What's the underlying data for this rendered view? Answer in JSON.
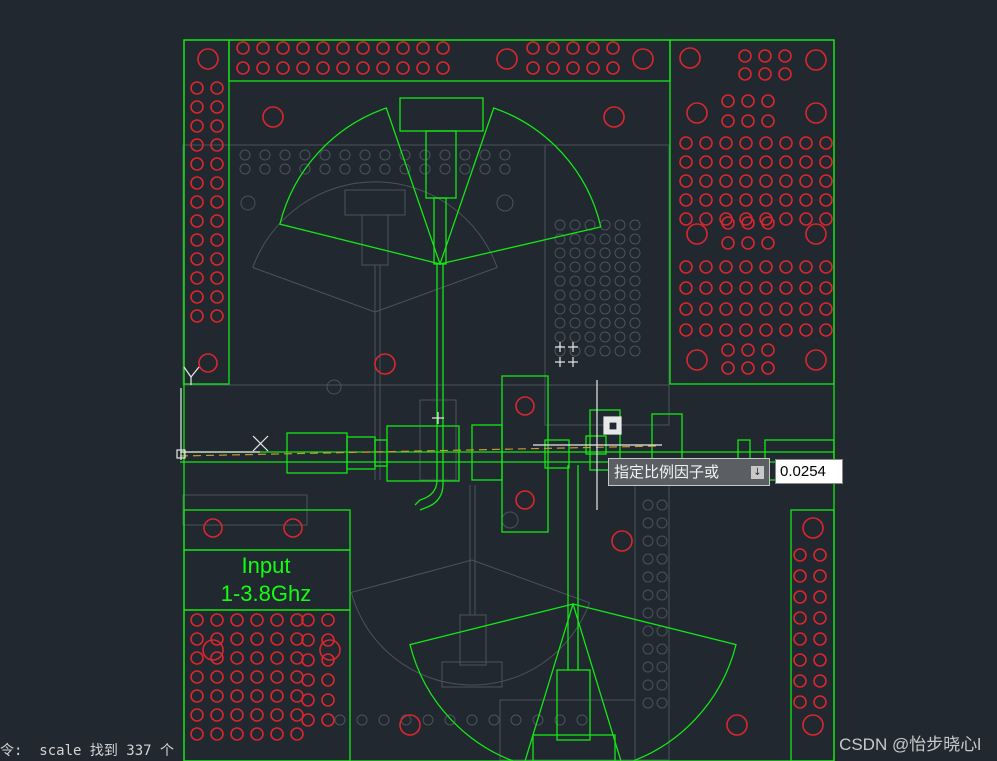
{
  "drawing": {
    "board_label_line1": "Input",
    "board_label_line2": "1-3.8Ghz",
    "colors": {
      "background": "#212830",
      "outline": "#15e615",
      "via_holes": "#d9272d",
      "background_layer": "#4b535a",
      "center_line": "#c99a2f",
      "label_text": "#10ff10"
    }
  },
  "command_prompt": {
    "label": "指定比例因子或",
    "dropdown_icon": "arrow-down-icon",
    "value": "0.0254"
  },
  "command_line": {
    "text": "令:  scale 找到 337 个"
  },
  "watermark": {
    "text": "CSDN @怡步晓心l"
  }
}
